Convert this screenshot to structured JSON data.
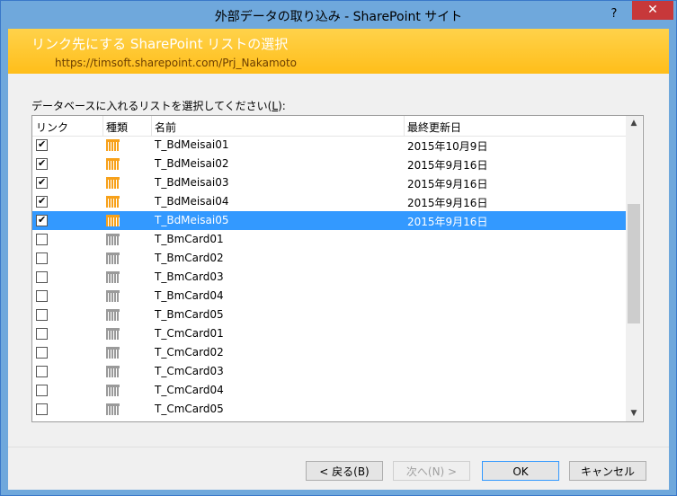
{
  "window": {
    "title": "外部データの取り込み - SharePoint サイト",
    "help_label": "?",
    "close_label": "✕"
  },
  "banner": {
    "title": "リンク先にする SharePoint リストの選択",
    "url": "https://timsoft.sharepoint.com/Prj_Nakamoto"
  },
  "instruction": {
    "text_before": "データベースに入れるリストを選択してください(",
    "accel": "L",
    "text_after": "):"
  },
  "columns": {
    "link": "リンク",
    "kind": "種類",
    "name": "名前",
    "modified": "最終更新日"
  },
  "rows": [
    {
      "checked": true,
      "name": "T_BdMeisai01",
      "date": "2015年10月9日",
      "kind": "table-colored-icon",
      "selected": false
    },
    {
      "checked": true,
      "name": "T_BdMeisai02",
      "date": "2015年9月16日",
      "kind": "table-colored-icon",
      "selected": false
    },
    {
      "checked": true,
      "name": "T_BdMeisai03",
      "date": "2015年9月16日",
      "kind": "table-colored-icon",
      "selected": false
    },
    {
      "checked": true,
      "name": "T_BdMeisai04",
      "date": "2015年9月16日",
      "kind": "table-colored-icon",
      "selected": false
    },
    {
      "checked": true,
      "name": "T_BdMeisai05",
      "date": "2015年9月16日",
      "kind": "table-colored-icon",
      "selected": true
    },
    {
      "checked": false,
      "name": "T_BmCard01",
      "date": "",
      "kind": "table-gray-icon",
      "selected": false
    },
    {
      "checked": false,
      "name": "T_BmCard02",
      "date": "",
      "kind": "table-gray-icon",
      "selected": false
    },
    {
      "checked": false,
      "name": "T_BmCard03",
      "date": "",
      "kind": "table-gray-icon",
      "selected": false
    },
    {
      "checked": false,
      "name": "T_BmCard04",
      "date": "",
      "kind": "table-gray-icon",
      "selected": false
    },
    {
      "checked": false,
      "name": "T_BmCard05",
      "date": "",
      "kind": "table-gray-icon",
      "selected": false
    },
    {
      "checked": false,
      "name": "T_CmCard01",
      "date": "",
      "kind": "table-gray-icon",
      "selected": false
    },
    {
      "checked": false,
      "name": "T_CmCard02",
      "date": "",
      "kind": "table-gray-icon",
      "selected": false
    },
    {
      "checked": false,
      "name": "T_CmCard03",
      "date": "",
      "kind": "table-gray-icon",
      "selected": false
    },
    {
      "checked": false,
      "name": "T_CmCard04",
      "date": "",
      "kind": "table-gray-icon",
      "selected": false
    },
    {
      "checked": false,
      "name": "T_CmCard05",
      "date": "",
      "kind": "table-gray-icon",
      "selected": false
    }
  ],
  "buttons": {
    "back": "< 戻る(B)",
    "next": "次へ(N) >",
    "ok": "OK",
    "cancel": "キャンセル"
  },
  "colors": {
    "title_bar": "#6fa8dc",
    "banner": "#ffbe1a",
    "selection": "#3399ff",
    "close": "#c7383a",
    "table_icon": "#f7a11a",
    "table_icon_gray": "#9a9a9a"
  }
}
